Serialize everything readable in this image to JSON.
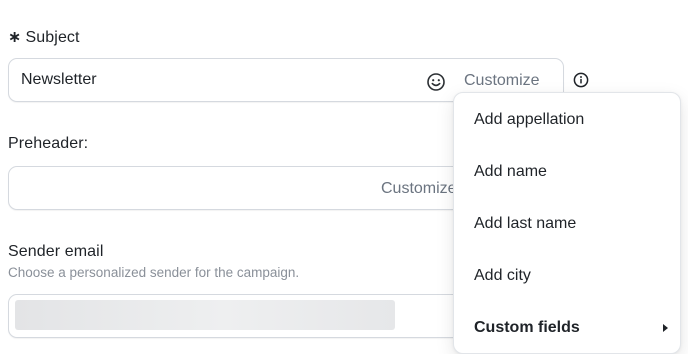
{
  "subject": {
    "required_mark": "∗",
    "label": "Subject",
    "value": "Newsletter",
    "customize_label": "Customize"
  },
  "preheader": {
    "label": "Preheader:",
    "value": "",
    "customize_label": "Customize"
  },
  "sender": {
    "label": "Sender email",
    "helper": "Choose a personalized sender for the campaign.",
    "value_state": "loading"
  },
  "customize_menu": {
    "items": [
      {
        "label": "Add appellation"
      },
      {
        "label": "Add name"
      },
      {
        "label": "Add last name"
      },
      {
        "label": "Add city"
      },
      {
        "label": "Custom fields",
        "has_submenu": true
      }
    ]
  },
  "icons": {
    "emoji": "smiley-icon",
    "info": "info-icon",
    "submenu": "chevron-right-icon"
  }
}
